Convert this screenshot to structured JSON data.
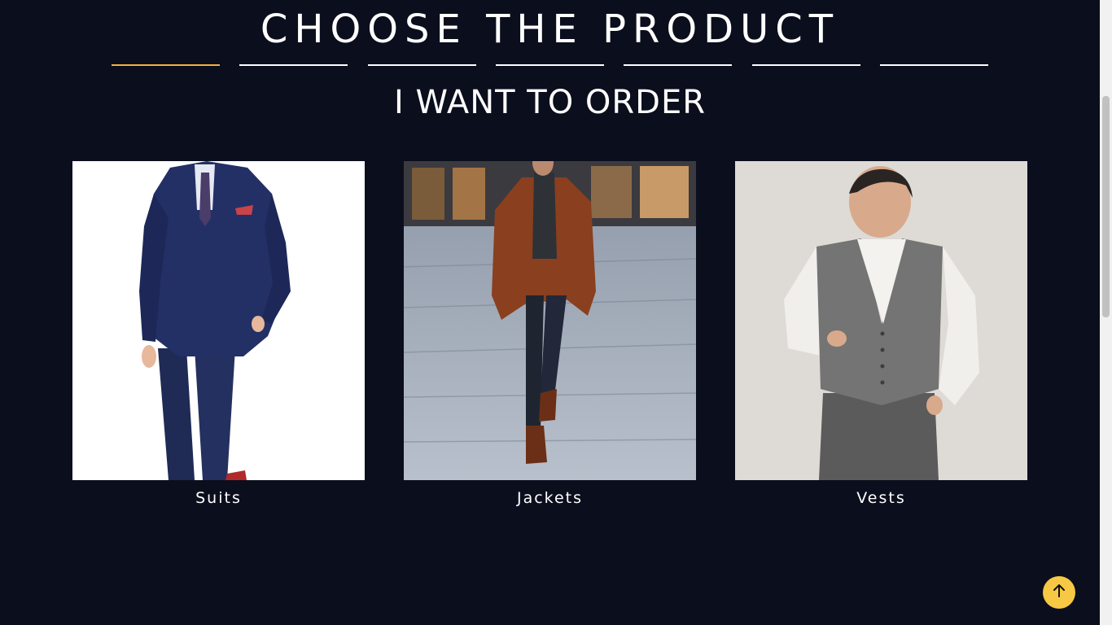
{
  "header": {
    "title": "CHOOSE THE PRODUCT",
    "steps": [
      {
        "active": true
      },
      {
        "active": false
      },
      {
        "active": false
      },
      {
        "active": false
      },
      {
        "active": false
      },
      {
        "active": false
      },
      {
        "active": false
      }
    ]
  },
  "section": {
    "subtitle": "I WANT TO ORDER"
  },
  "products": [
    {
      "label": "Suits",
      "image": "navy-three-piece-suit-photo"
    },
    {
      "label": "Jackets",
      "image": "brown-overcoat-street-photo"
    },
    {
      "label": "Vests",
      "image": "grey-waistcoat-photo"
    }
  ],
  "scroll_top": {
    "icon": "arrow-up-icon"
  },
  "colors": {
    "background": "#0b0e1d",
    "accent": "#f2b33d",
    "scroll_button": "#f7c843"
  }
}
